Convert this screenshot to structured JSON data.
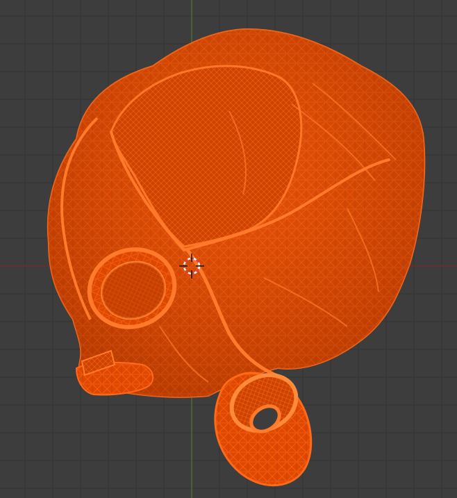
{
  "viewport": {
    "background": "#3d3d3d",
    "grid_color": "#343434",
    "x_axis_color": "#7a2a2a",
    "y_axis_color": "#4f7a2c"
  },
  "selection": {
    "state": "selected",
    "wireframe_color": "#e84a00",
    "wire_highlight": "#ff6a1a",
    "wire_shadow": "#b83600"
  },
  "cursor": {
    "icon": "3d-cursor-icon",
    "ring_color_a": "#ffffff",
    "ring_color_b": "#d94040"
  }
}
